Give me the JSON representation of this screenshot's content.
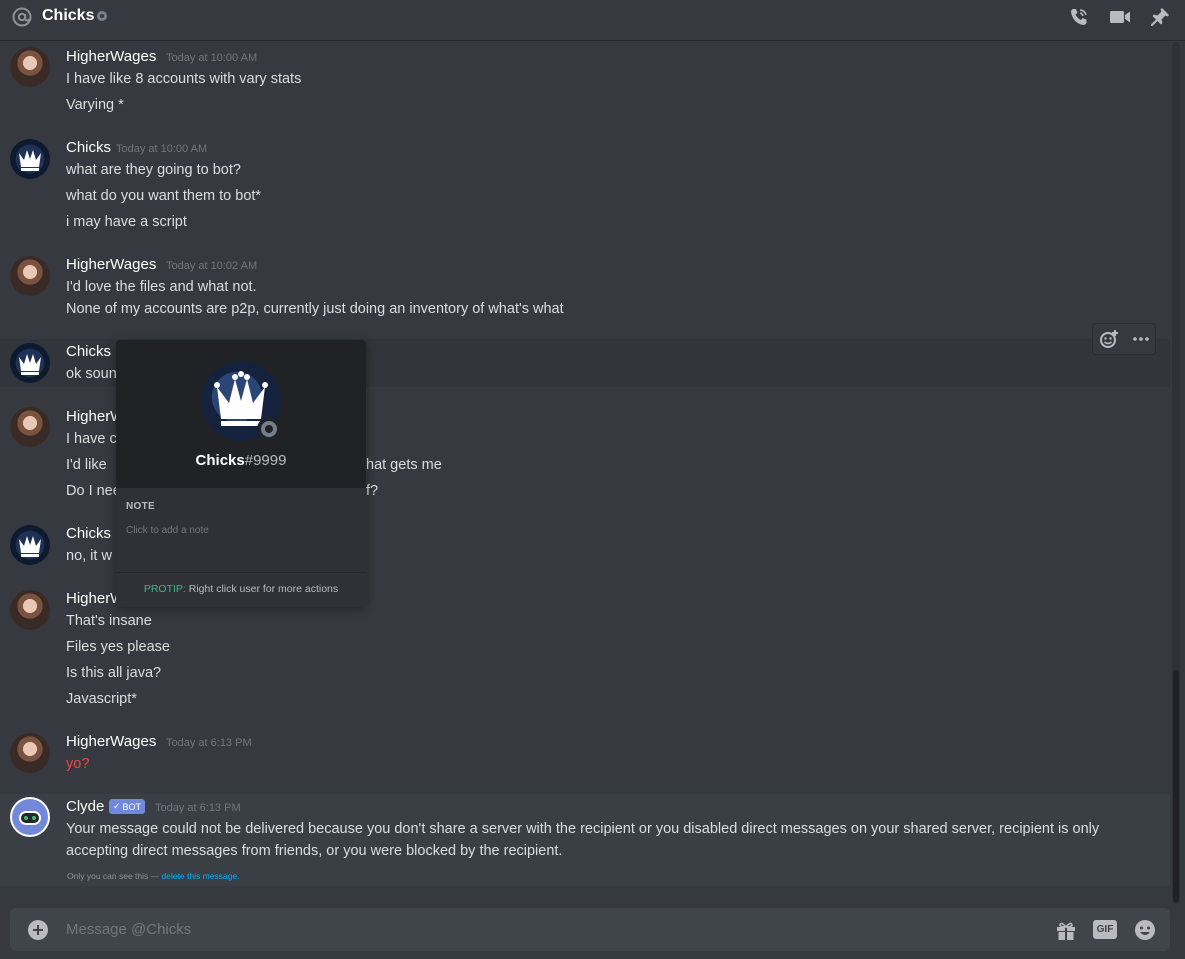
{
  "header": {
    "channel_name": "Chicks",
    "icons": [
      "at-icon",
      "phone-call-icon",
      "video-call-icon",
      "pin-icon"
    ]
  },
  "messages": [
    {
      "author": "HigherWages",
      "timestamp": "Today at 10:00 AM",
      "lines": [
        "I have like 8 accounts with vary stats",
        "Varying *"
      ]
    },
    {
      "author": "Chicks",
      "timestamp": "Today at 10:00 AM",
      "lines": [
        "what are they going to bot?",
        "what do you want them to bot*",
        "i may have a script"
      ]
    },
    {
      "author": "HigherWages",
      "timestamp": "Today at 10:02 AM",
      "lines": [
        "I'd love the files and what not.",
        "None of my accounts are p2p, currently just doing an inventory of what's what"
      ]
    },
    {
      "author": "Chicks",
      "lines": [
        "ok soun"
      ]
    },
    {
      "author": "HigherW",
      "lines": [
        "I have c",
        "I'd like",
        "hat gets me",
        "Do I nee",
        "f?"
      ]
    },
    {
      "author": "Chicks",
      "lines": [
        "no, it w"
      ]
    },
    {
      "author": "HigherW",
      "lines": [
        "That's insane",
        "Files yes please",
        "Is this all java?",
        "Javascript*"
      ]
    },
    {
      "author": "HigherWages",
      "timestamp": "Today at 6:13 PM",
      "lines": [
        "yo?"
      ]
    },
    {
      "author": "Clyde",
      "badge": "BOT",
      "timestamp": "Today at 6:13 PM",
      "lines": [
        "Your message could not be delivered because you don't share a server with the recipient or you disabled direct messages on your shared server, recipient is only accepting direct messages from friends, or you were blocked by the recipient."
      ],
      "footer_prefix": "Only you can see this — ",
      "footer_link": "delete this message."
    }
  ],
  "popout": {
    "username": "Chicks",
    "discriminator": "#9999",
    "note_heading": "NOTE",
    "note_placeholder": "Click to add a note",
    "protip_label": "PROTIP:",
    "protip_text": " Right click user for more actions"
  },
  "composer": {
    "placeholder": "Message @Chicks",
    "gif_label": "GIF"
  },
  "colors": {
    "background": "#36393f",
    "error_text": "#f04747",
    "link": "#00b0f4",
    "bot_badge": "#7289da",
    "protip": "#43b581"
  }
}
